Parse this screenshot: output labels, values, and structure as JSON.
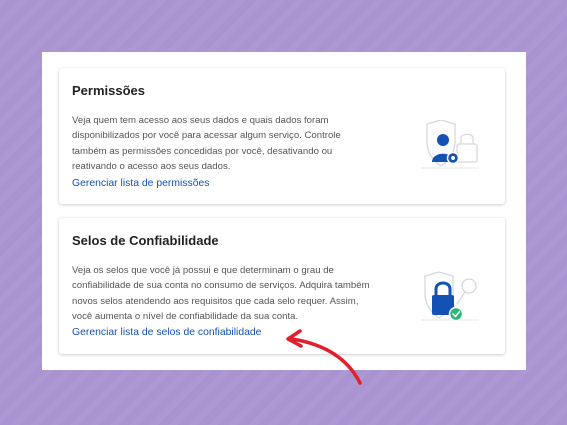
{
  "cards": [
    {
      "title": "Permissões",
      "text": "Veja quem tem acesso aos seus dados e quais dados foram disponibilizados por você para acessar algum serviço. Controle também as permissões concedidas por você, desativando ou reativando o acesso aos seus dados.",
      "link": "Gerenciar lista de permissões",
      "icon": "user-shield-icon"
    },
    {
      "title": "Selos de Confiabilidade",
      "text": "Veja os selos que você já possui e que determinam o grau de confiabilidade de sua conta no consumo de serviços. Adquira também novos selos atendendo aos requisitos que cada selo requer. Assim, você aumenta o nível de confiabilidade da sua conta.",
      "link": "Gerenciar lista de selos de confiabilidade",
      "icon": "padlock-check-icon"
    }
  ],
  "annotation": {
    "icon": "red-arrow-icon",
    "color": "#e0202a"
  },
  "colors": {
    "background": "#a993d1",
    "link": "#1351b4",
    "icon_blue": "#1351b4",
    "check_green": "#2bb673"
  }
}
